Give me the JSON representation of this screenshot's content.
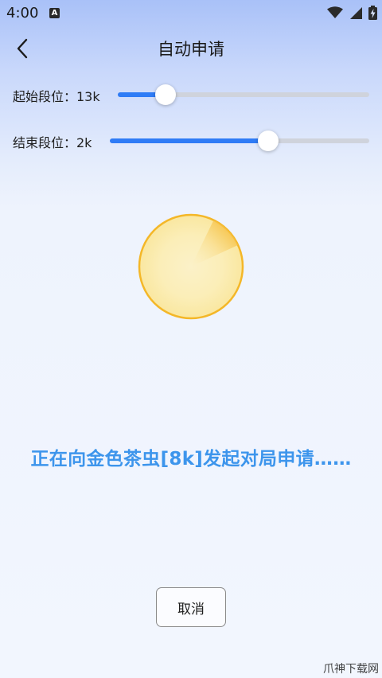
{
  "status_bar": {
    "time": "4:00",
    "notification_icon": "a-notification-icon",
    "icons": [
      "wifi-icon",
      "cellular-icon",
      "battery-charging-icon"
    ]
  },
  "header": {
    "title": "自动申请",
    "back_icon": "chevron-left-icon"
  },
  "sliders": [
    {
      "label": "起始段位：13k",
      "fraction": 0.19
    },
    {
      "label": "结束段位：2k",
      "fraction": 0.61
    }
  ],
  "colors": {
    "accent": "#2f7cf6",
    "status_text": "#3d95ec",
    "radar_ring": "#f4b728",
    "radar_sweep": "#f5b321"
  },
  "status_message": "正在向金色茶虫[8k]发起对局申请……",
  "cancel_button": {
    "label": "取消"
  },
  "watermark": "爪神下载网"
}
